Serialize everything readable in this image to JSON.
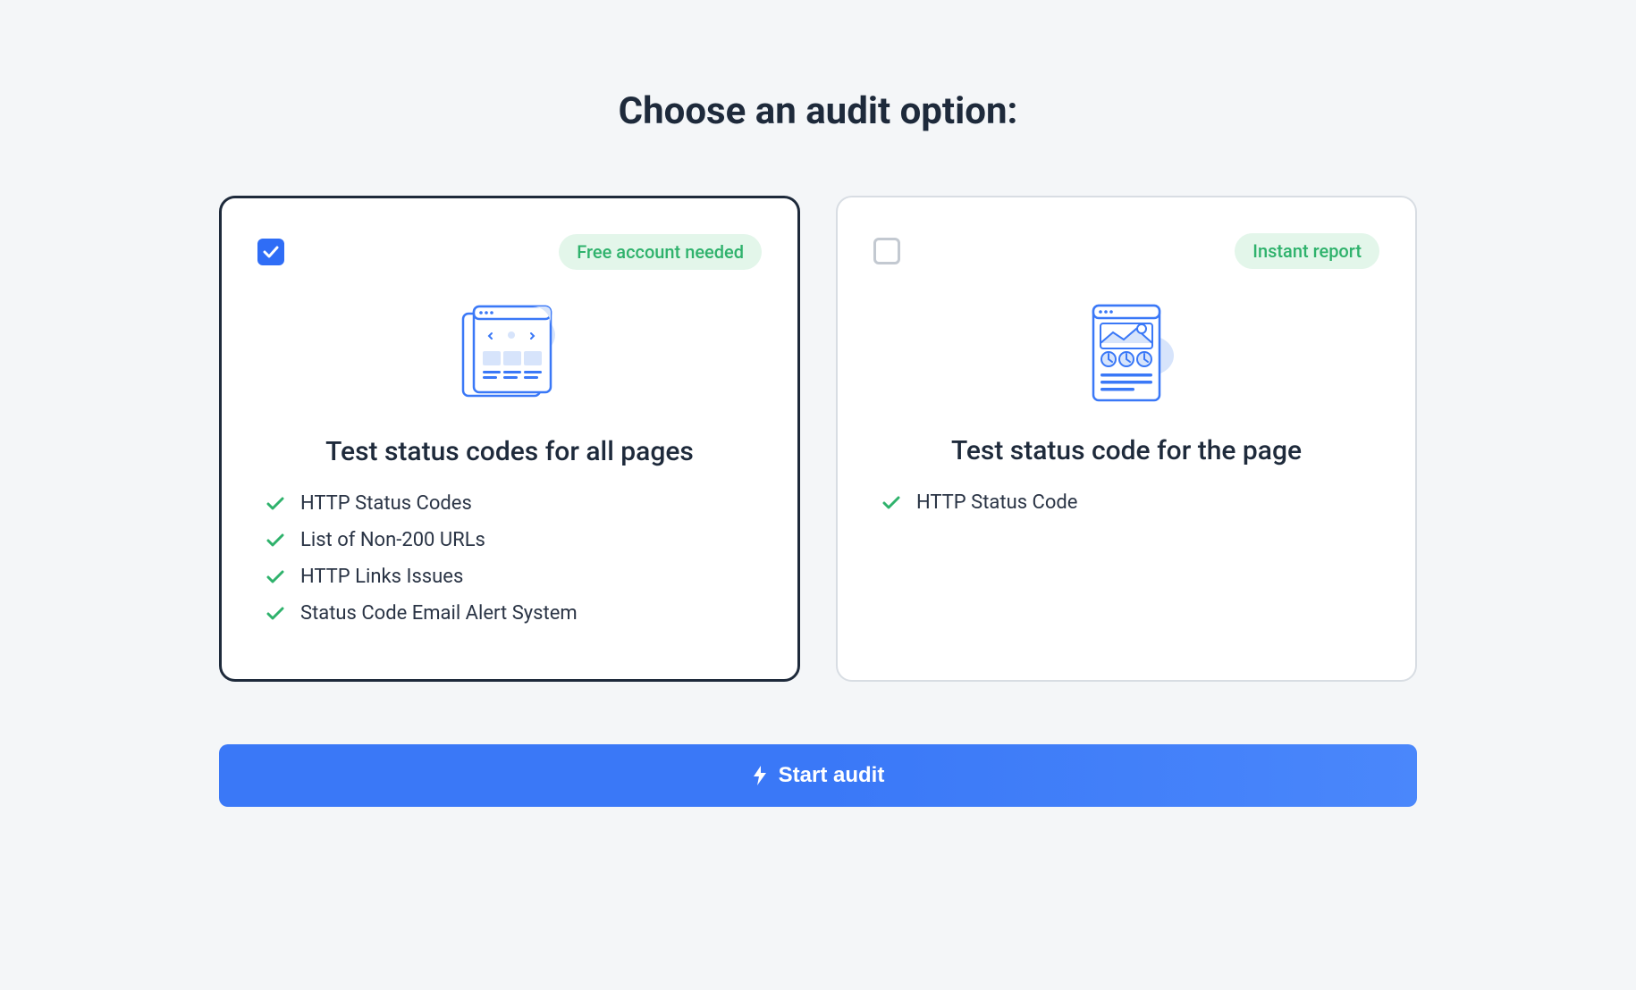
{
  "title": "Choose an audit option:",
  "options": [
    {
      "selected": true,
      "badge": "Free account needed",
      "heading": "Test status codes for all pages",
      "features": [
        "HTTP Status Codes",
        "List of Non-200 URLs",
        "HTTP Links Issues",
        "Status Code Email Alert System"
      ]
    },
    {
      "selected": false,
      "badge": "Instant report",
      "heading": "Test status code for the page",
      "features": [
        "HTTP Status Code"
      ]
    }
  ],
  "cta_label": "Start audit"
}
